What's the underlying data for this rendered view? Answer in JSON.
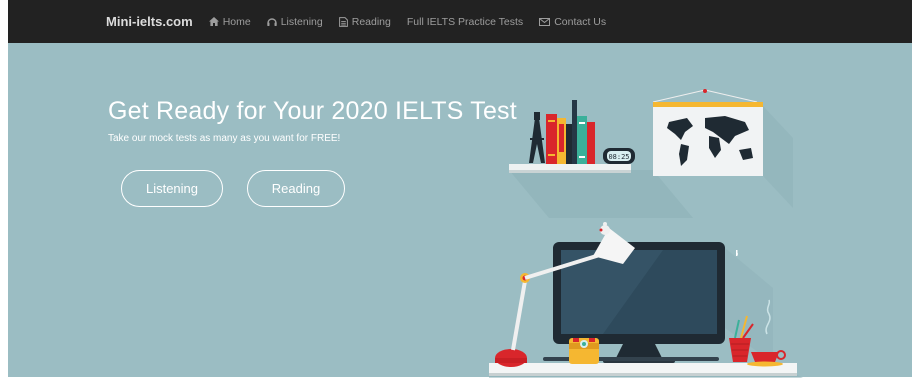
{
  "nav": {
    "brand": "Mini-ielts.com",
    "items": [
      {
        "label": "Home",
        "icon": "home-icon"
      },
      {
        "label": "Listening",
        "icon": "headphones-icon"
      },
      {
        "label": "Reading",
        "icon": "document-icon"
      },
      {
        "label": "Full IELTS Practice Tests",
        "icon": ""
      },
      {
        "label": "Contact Us",
        "icon": "envelope-icon"
      }
    ]
  },
  "hero": {
    "title": "Get Ready for Your 2020 IELTS Test",
    "subtitle": "Take our mock tests as many as you want for FREE!",
    "buttons": {
      "listening": "Listening",
      "reading": "Reading"
    },
    "clock": "08:25"
  },
  "colors": {
    "navbar": "#222222",
    "hero_bg": "#9bbdc3",
    "accent_red": "#d9262b",
    "accent_yellow": "#f5b731"
  }
}
